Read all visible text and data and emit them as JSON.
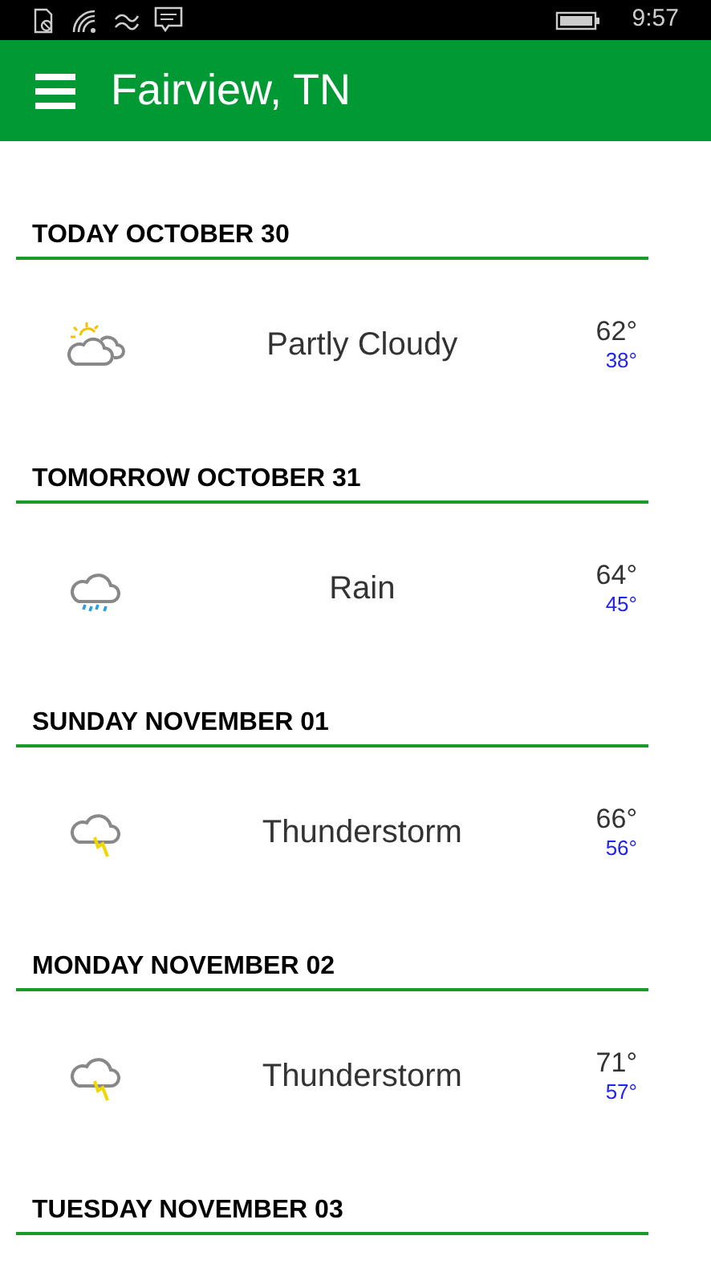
{
  "status_bar": {
    "time": "9:57"
  },
  "header": {
    "title": "Fairview, TN"
  },
  "days": [
    {
      "date": "TODAY OCTOBER 30",
      "forecast": {
        "kind": "partly_cloudy",
        "condition": "Partly Cloudy",
        "high": "62°",
        "low": "38°"
      }
    },
    {
      "date": "TOMORROW OCTOBER 31",
      "forecast": {
        "kind": "rain",
        "condition": "Rain",
        "high": "64°",
        "low": "45°"
      }
    },
    {
      "date": "SUNDAY NOVEMBER 01",
      "forecast": {
        "kind": "thunderstorm",
        "condition": "Thunderstorm",
        "high": "66°",
        "low": "56°"
      }
    },
    {
      "date": "MONDAY NOVEMBER 02",
      "forecast": {
        "kind": "thunderstorm",
        "condition": "Thunderstorm",
        "high": "71°",
        "low": "57°"
      }
    },
    {
      "date": "TUESDAY NOVEMBER 03"
    }
  ]
}
